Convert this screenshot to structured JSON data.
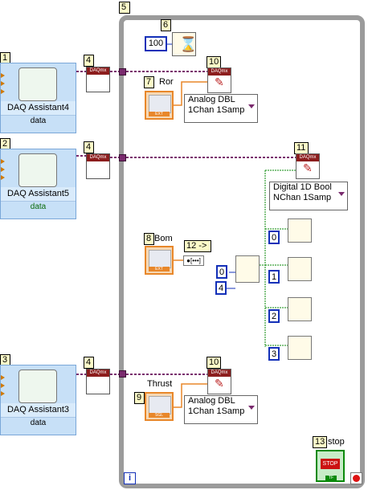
{
  "labels": {
    "n1": "1",
    "n2": "2",
    "n3": "3",
    "n4a": "4",
    "n4b": "4",
    "n4c": "4",
    "n5": "5",
    "n6": "6",
    "n7": "7",
    "n8": "8",
    "n9": "9",
    "n10a": "10",
    "n10b": "10",
    "n11": "11",
    "n12": "12 ->",
    "n13": "13"
  },
  "daq": [
    {
      "title": "DAQ Assistant4",
      "port": "data"
    },
    {
      "title": "DAQ Assistant5",
      "port": "data"
    },
    {
      "title": "DAQ Assistant3",
      "port": "data"
    }
  ],
  "constants": {
    "wait": "100",
    "i0": "0",
    "i4": "4",
    "c0": "0",
    "c1": "1",
    "c2": "2",
    "c3": "3"
  },
  "controls": {
    "ror": "Ror",
    "bom": "Bom",
    "thrust": "Thrust",
    "stop": "stop",
    "iter": "i"
  },
  "poly": {
    "analog1": [
      "Analog DBL",
      "1Chan 1Samp"
    ],
    "digital": [
      "Digital 1D Bool",
      "NChan 1Samp"
    ],
    "analog2": [
      "Analog DBL",
      "1Chan 1Samp"
    ]
  },
  "colors": {
    "wire_daq": "#7a2b6e",
    "wire_bool": "#0a8a0a",
    "wire_num": "#e8872a",
    "int_const": "#1330b8",
    "loop": "#9b9b9b"
  }
}
